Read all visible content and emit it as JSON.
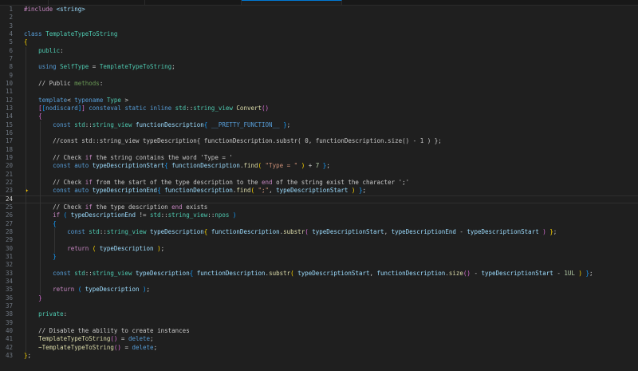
{
  "tabs": [
    {
      "label": "",
      "active": false
    },
    {
      "label": "",
      "active": false
    },
    {
      "label": "",
      "active": false
    },
    {
      "label": "",
      "active": true
    }
  ],
  "editor": {
    "current_line": 24,
    "lightbulb_line": 23,
    "lines": [
      "#include <string>",
      "",
      "",
      "class TemplateTypeToString",
      "{",
      "    public:",
      "",
      "    using SelfType = TemplateTypeToString;",
      "",
      "    // Public methods:",
      "",
      "    template< typename Type >",
      "    [[nodiscard]] consteval static inline std::string_view Convert()",
      "    {",
      "        const std::string_view functionDescription{ __PRETTY_FUNCTION__ };",
      "",
      "        //const std::string_view typeDescription{ functionDescription.substr( 0, functionDescription.size() - 1 ) };",
      "",
      "        // Check if the string contains the word 'Type = '",
      "        const auto typeDescriptionStart{ functionDescription.find( \"Type = \" ) + 7 };",
      "",
      "        // Check if from the start of the type description to the end of the string exist the character ';'",
      "        const auto typeDescriptionEnd{ functionDescription.find( \";\", typeDescriptionStart ) };",
      "",
      "        // Check if the type description end exists",
      "        if ( typeDescriptionEnd != std::string_view::npos )",
      "        {",
      "            const std::string_view typeDescription{ functionDescription.substr( typeDescriptionStart, typeDescriptionEnd - typeDescriptionStart ) };",
      "",
      "            return ( typeDescription );",
      "        }",
      "",
      "        const std::string_view typeDescription{ functionDescription.substr( typeDescriptionStart, functionDescription.size() - typeDescriptionStart - 1UL ) };",
      "",
      "        return ( typeDescription );",
      "    }",
      "",
      "    private:",
      "",
      "    // Disable the ability to create instances",
      "    TemplateTypeToString() = delete;",
      "    ~TemplateTypeToString() = delete;",
      "};"
    ]
  }
}
